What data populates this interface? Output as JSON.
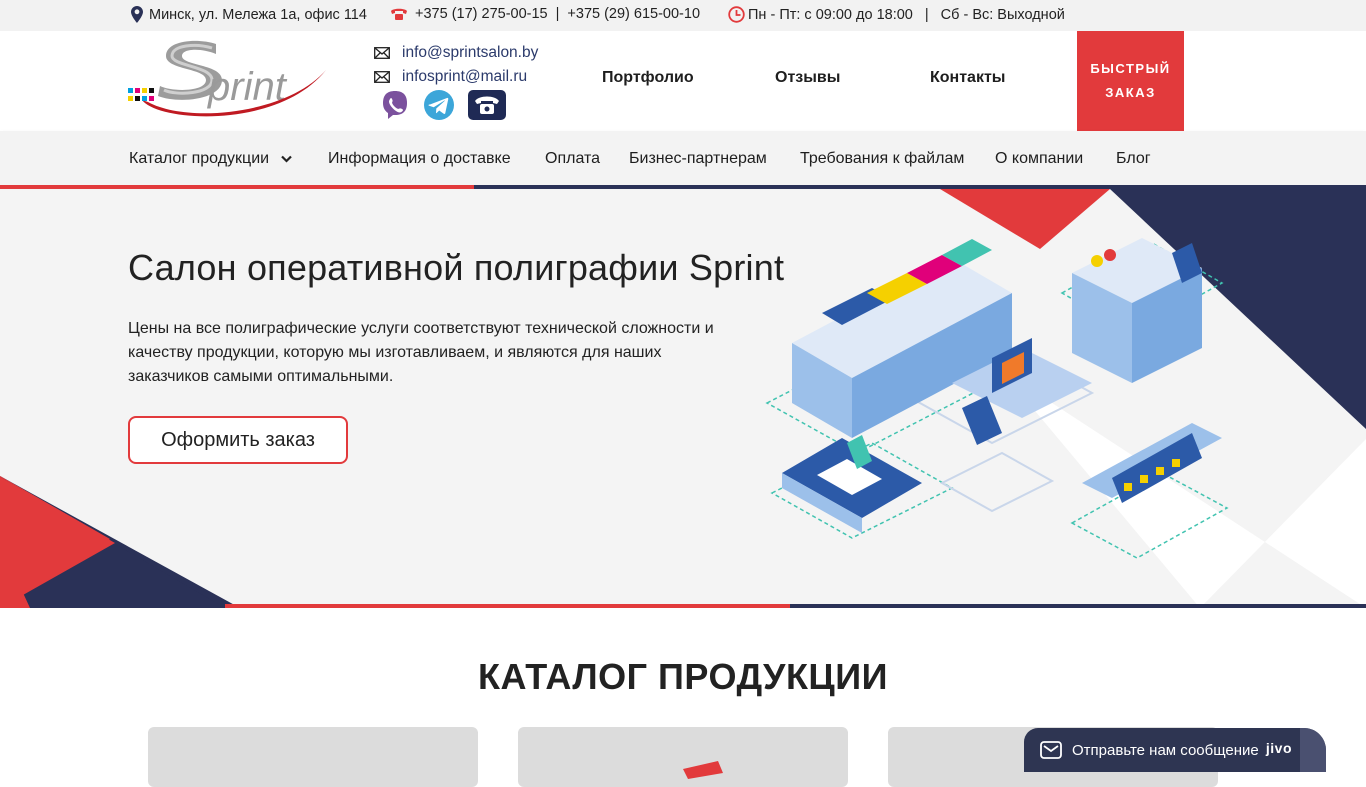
{
  "topbar": {
    "address": "Минск, ул. Мележа 1а, офис 114",
    "phone1": "+375 (17) 275-00-15",
    "phone_sep": "|",
    "phone2": "+375 (29) 615-00-10",
    "hours_weekdays": "Пн - Пт: с 09:00 до 18:00",
    "hours_sep": "|",
    "hours_weekend": "Сб - Вс: Выходной"
  },
  "header": {
    "logo_alt": "Sprint",
    "email1": "info@sprintsalon.by",
    "email2": "infosprint@mail.ru",
    "nav": [
      "Портфолио",
      "Отзывы",
      "Контакты"
    ],
    "quick_order_line1": "БЫСТРЫЙ",
    "quick_order_line2": "ЗАКАЗ",
    "messengers": [
      "viber-icon",
      "telegram-icon",
      "phone-icon"
    ]
  },
  "menu": {
    "items": [
      "Каталог продукции",
      "Информация о доставке",
      "Оплата",
      "Бизнес-партнерам",
      "Требования к файлам",
      "О компании",
      "Блог"
    ]
  },
  "hero": {
    "title": "Салон оперативной полиграфии Sprint",
    "text": "Цены на все полиграфические услуги соответствуют технической сложности и качеству продукции, которую мы изготавливаем, и являются для наших заказчиков самыми оптимальными.",
    "button": "Оформить заказ"
  },
  "catalog": {
    "title": "КАТАЛОГ ПРОДУКЦИИ"
  },
  "chat": {
    "label": "Отправьте нам сообщение",
    "brand": "jivo"
  },
  "colors": {
    "accent_red": "#e23a3c",
    "navy": "#2a3157",
    "link_blue": "#2b3a6b"
  }
}
